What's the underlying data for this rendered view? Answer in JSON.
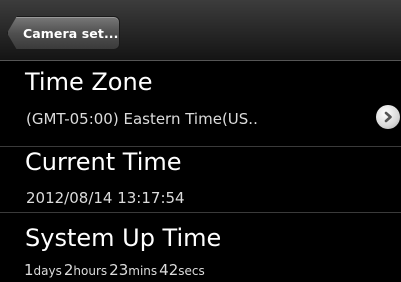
{
  "header": {
    "back_label": "Camera set..."
  },
  "time_zone": {
    "title": "Time Zone",
    "value": "(GMT-05:00) Eastern Time(US.."
  },
  "current_time": {
    "title": "Current Time",
    "value": "2012/08/14 13:17:54"
  },
  "system_up_time": {
    "title": "System Up Time",
    "days": "1",
    "days_unit": "days",
    "hours": "2",
    "hours_unit": "hours",
    "mins": "23",
    "mins_unit": "mins",
    "secs": "42",
    "secs_unit": "secs"
  },
  "icons": {
    "chevron": "chevron-right-icon"
  }
}
